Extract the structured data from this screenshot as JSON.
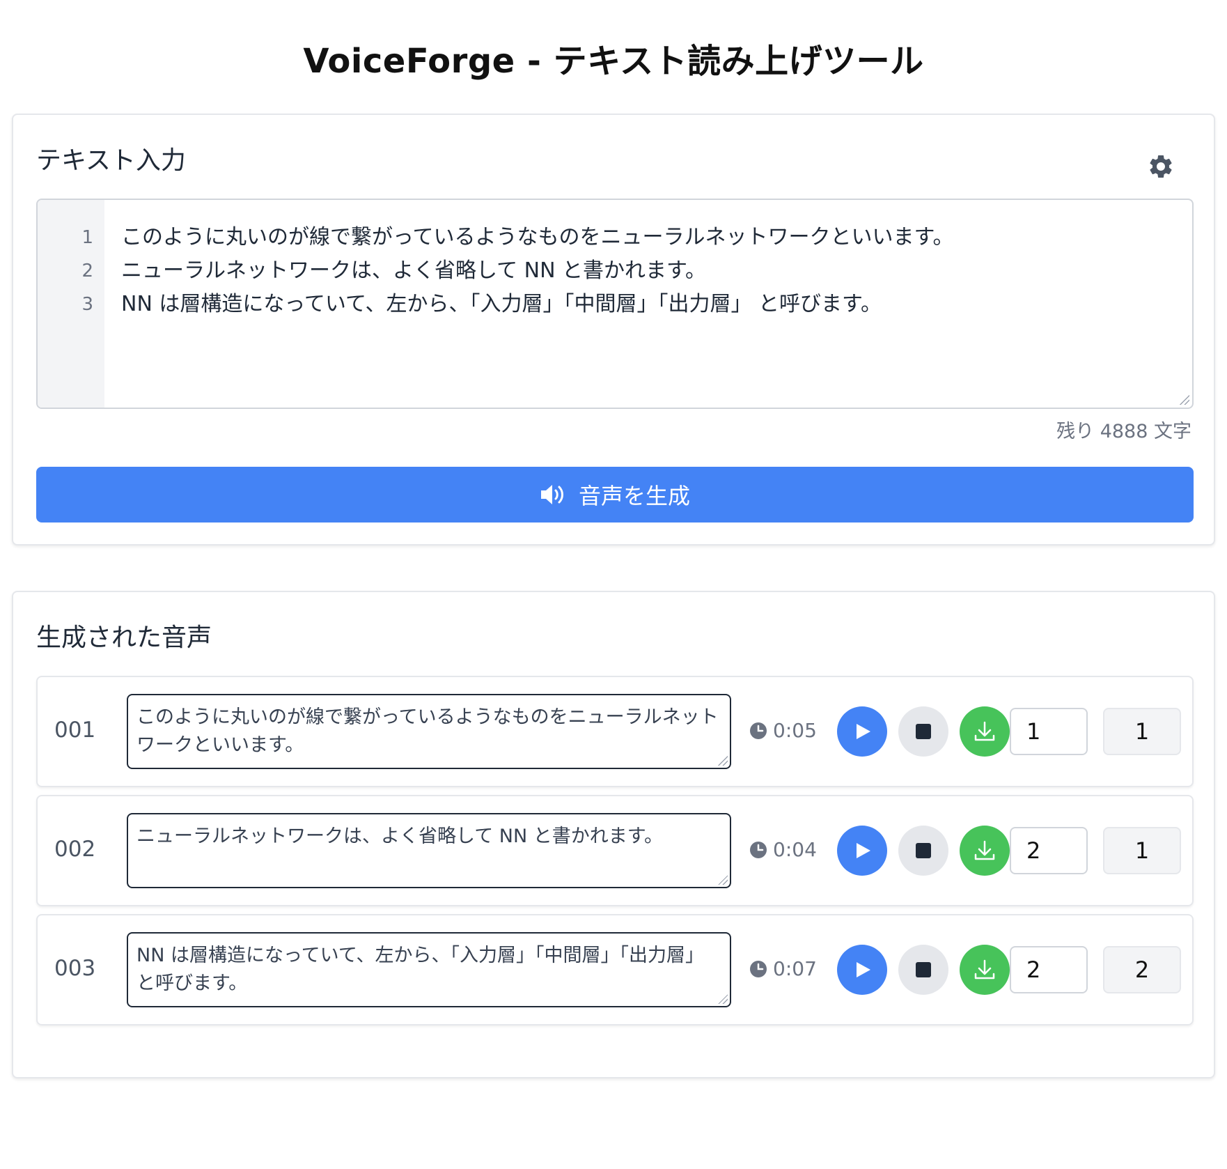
{
  "app": {
    "title": "VoiceForge - テキスト読み上げツール"
  },
  "input_section": {
    "title": "テキスト入力",
    "settings_icon": "gear-icon",
    "lines": [
      {
        "num": "1",
        "text": "このように丸いのが線で繋がっているようなものをニューラルネットワークといいます。"
      },
      {
        "num": "2",
        "text": "ニューラルネットワークは、よく省略して NN と書かれます。"
      },
      {
        "num": "3",
        "text": "NN は層構造になっていて、左から、「入力層」「中間層」「出力層」 と呼びます。"
      }
    ],
    "char_count": "残り 4888 文字",
    "generate_label": "音声を生成",
    "generate_icon": "speaker-icon"
  },
  "output_section": {
    "title": "生成された音声",
    "rows": [
      {
        "id": "001",
        "text": "このように丸いのが線で繋がっているようなものをニューラルネットワークといいます。",
        "duration": "0:05",
        "speed": "1",
        "speaker": "1"
      },
      {
        "id": "002",
        "text": "ニューラルネットワークは、よく省略して NN と書かれます。",
        "duration": "0:04",
        "speed": "2",
        "speaker": "1"
      },
      {
        "id": "003",
        "text": "NN は層構造になっていて、左から、「入力層」「中間層」「出力層」 と呼びます。",
        "duration": "0:07",
        "speed": "2",
        "speaker": "2"
      }
    ]
  },
  "colors": {
    "primary": "#4483f5",
    "success": "#47c35a",
    "stop_bg": "#e5e7eb"
  }
}
